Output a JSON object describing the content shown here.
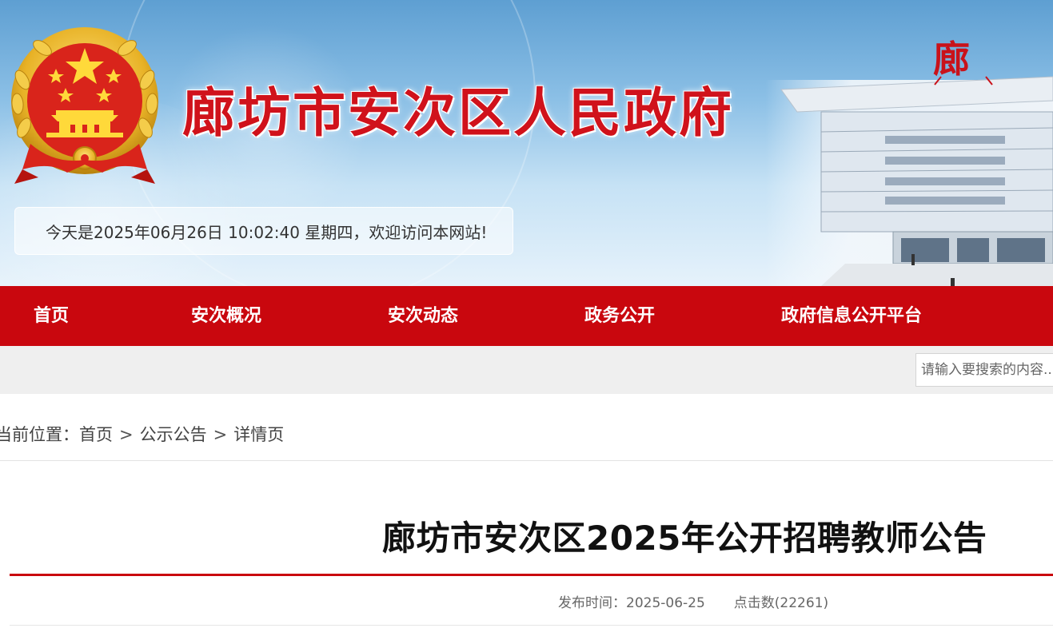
{
  "header": {
    "site_title": "廊坊市安次区人民政府",
    "building_sign": "廊",
    "date_text": "今天是2025年06月26日 10:02:40 星期四，欢迎访问本网站!",
    "emblem_icon": "national-emblem-icon"
  },
  "nav": {
    "items": [
      {
        "label": "首页"
      },
      {
        "label": "安次概况"
      },
      {
        "label": "安次动态"
      },
      {
        "label": "政务公开"
      },
      {
        "label": "政府信息公开平台"
      }
    ],
    "color": "#c9070e"
  },
  "search": {
    "placeholder": "请输入要搜索的内容..."
  },
  "breadcrumb": {
    "prefix": "当前位置：",
    "items": [
      "首页",
      "公示公告",
      "详情页"
    ],
    "separator": ">"
  },
  "article": {
    "title": "廊坊市安次区2025年公开招聘教师公告",
    "published_label": "发布时间：",
    "published_date": "2025-06-25",
    "views_text": "点击数(22261)"
  },
  "colors": {
    "brand_red": "#c9070e",
    "title_red": "#d0121b",
    "sky_blue": "#8cc0e6"
  }
}
